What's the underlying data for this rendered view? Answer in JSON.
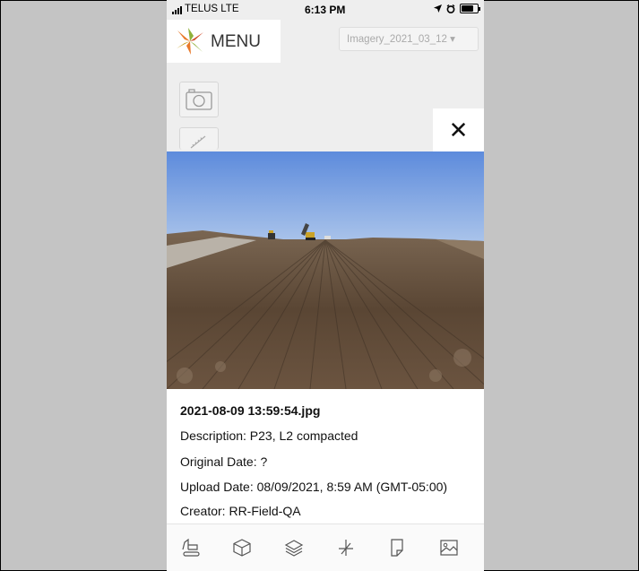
{
  "status_bar": {
    "carrier": "TELUS  LTE",
    "time": "6:13 PM"
  },
  "header": {
    "menu_label": "MENU",
    "imagery_select": "Imagery_2021_03_12 ▾"
  },
  "modal": {
    "close_label": "✕",
    "filename": "2021-08-09 13:59:54.jpg",
    "description": "Description: P23, L2 compacted",
    "original_date": "Original Date: ?",
    "upload_date": "Upload Date: 08/09/2021, 8:59 AM (GMT-05:00)",
    "creator": "Creator: RR-Field-QA"
  },
  "icons": {
    "logo": "star-logo-icon",
    "camera": "camera-icon",
    "ruler": "ruler-icon",
    "bottom": [
      "excavator-icon",
      "cube-icon",
      "layers-icon",
      "crosshair-icon",
      "document-icon",
      "image-icon"
    ]
  },
  "colors": {
    "sky": "#6f98e0",
    "soil": "#5a4634",
    "logo_orange": "#e8792a",
    "logo_green": "#8fb13b"
  }
}
